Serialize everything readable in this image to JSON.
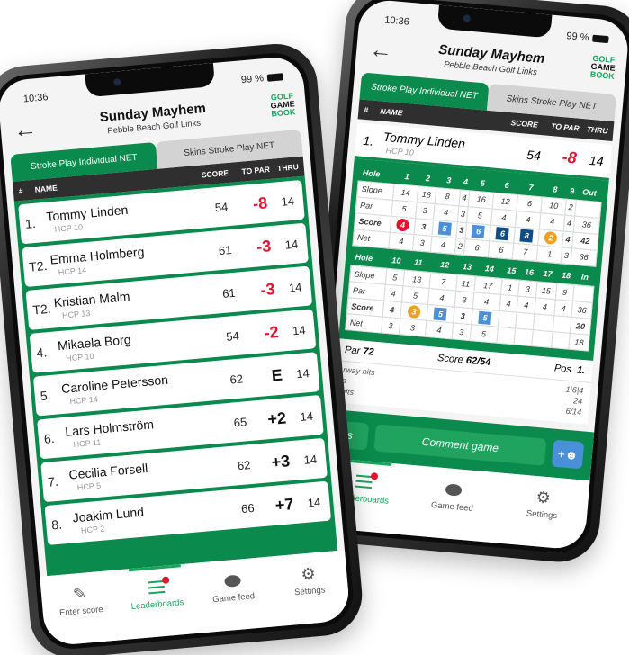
{
  "status": {
    "time": "10:36",
    "battery": "99 %"
  },
  "header": {
    "back_icon": "arrow-left",
    "title": "Sunday Mayhem",
    "subtitle": "Pebble Beach Golf Links",
    "logo": [
      "GOLF",
      "GAME",
      "BOOK"
    ]
  },
  "tabs": [
    {
      "label": "Stroke Play Individual NET",
      "active": true
    },
    {
      "label": "Skins Stroke Play NET",
      "active": false
    }
  ],
  "columns": {
    "num": "#",
    "name": "NAME",
    "score": "SCORE",
    "to_par": "TO PAR",
    "thru": "THRU"
  },
  "leaderboard": [
    {
      "pos": "1.",
      "name": "Tommy Linden",
      "hcp": "HCP 10",
      "score": "54",
      "to_par": "-8",
      "thru": "14"
    },
    {
      "pos": "T2.",
      "name": "Emma Holmberg",
      "hcp": "HCP 14",
      "score": "61",
      "to_par": "-3",
      "thru": "14"
    },
    {
      "pos": "T2.",
      "name": "Kristian Malm",
      "hcp": "HCP 13",
      "score": "61",
      "to_par": "-3",
      "thru": "14"
    },
    {
      "pos": "4.",
      "name": "Mikaela Borg",
      "hcp": "HCP 10",
      "score": "54",
      "to_par": "-2",
      "thru": "14"
    },
    {
      "pos": "5.",
      "name": "Caroline Petersson",
      "hcp": "HCP 14",
      "score": "62",
      "to_par": "E",
      "thru": "14"
    },
    {
      "pos": "6.",
      "name": "Lars Holmström",
      "hcp": "HCP 11",
      "score": "65",
      "to_par": "+2",
      "thru": "14"
    },
    {
      "pos": "7.",
      "name": "Cecilia Forsell",
      "hcp": "HCP 5",
      "score": "62",
      "to_par": "+3",
      "thru": "14"
    },
    {
      "pos": "8.",
      "name": "Joakim Lund",
      "hcp": "HCP 2",
      "score": "66",
      "to_par": "+7",
      "thru": "14"
    }
  ],
  "bottom_nav": [
    {
      "label": "Enter score",
      "icon": "pencil-icon"
    },
    {
      "label": "Leaderboards",
      "icon": "leaderboard-icon",
      "active": true
    },
    {
      "label": "Game feed",
      "icon": "chat-bubble-icon"
    },
    {
      "label": "Settings",
      "icon": "gear-icon"
    }
  ],
  "detail": {
    "player": {
      "pos": "1.",
      "name": "Tommy Linden",
      "hcp": "HCP 10",
      "score": "54",
      "to_par": "-8",
      "thru": "14"
    },
    "front": {
      "hole_label": "Hole",
      "holes": [
        "1",
        "2",
        "3",
        "4",
        "5",
        "6",
        "7",
        "8",
        "9"
      ],
      "total_label": "Out",
      "slope": {
        "label": "Slope",
        "values": [
          "14",
          "18",
          "8",
          "4",
          "16",
          "12",
          "6",
          "10",
          "2"
        ],
        "total": ""
      },
      "par": {
        "label": "Par",
        "values": [
          "5",
          "3",
          "4",
          "3",
          "5",
          "4",
          "4",
          "4",
          "4"
        ],
        "total": "36"
      },
      "score": {
        "label": "Score",
        "values": [
          "4",
          "3",
          "5",
          "3",
          "6",
          "6",
          "8",
          "2",
          "4"
        ],
        "marks": [
          "eagle",
          "",
          "bogey",
          "",
          "bogey",
          "dbl",
          "dbl",
          "birdie",
          ""
        ],
        "total": "42"
      },
      "net": {
        "label": "Net",
        "values": [
          "4",
          "3",
          "4",
          "2",
          "6",
          "6",
          "7",
          "1",
          "3"
        ],
        "total": "36"
      }
    },
    "back": {
      "hole_label": "Hole",
      "holes": [
        "10",
        "11",
        "12",
        "13",
        "14",
        "15",
        "16",
        "17",
        "18"
      ],
      "total_label": "In",
      "slope": {
        "label": "Slope",
        "values": [
          "5",
          "13",
          "7",
          "11",
          "17",
          "1",
          "3",
          "15",
          "9"
        ],
        "total": ""
      },
      "par": {
        "label": "Par",
        "values": [
          "4",
          "5",
          "4",
          "3",
          "4",
          "4",
          "4",
          "4",
          "4"
        ],
        "total": "36"
      },
      "score": {
        "label": "Score",
        "values": [
          "4",
          "3",
          "5",
          "3",
          "5",
          "",
          "",
          "",
          ""
        ],
        "marks": [
          "",
          "birdie",
          "bogey",
          "",
          "bogey",
          "",
          "",
          "",
          ""
        ],
        "total": "20"
      },
      "net": {
        "label": "Net",
        "values": [
          "3",
          "3",
          "4",
          "3",
          "5",
          "",
          "",
          "",
          ""
        ],
        "total": "18"
      }
    },
    "summary": {
      "par_label": "Par",
      "par": "72",
      "score_label": "Score",
      "score": "62/54",
      "pos_label": "Pos.",
      "pos": "1."
    },
    "stats": [
      {
        "label": "rway hits",
        "value": "1|6|4"
      },
      {
        "label": "s",
        "value": "24"
      },
      {
        "label": "hits",
        "value": "6/14"
      }
    ],
    "actions": {
      "partial_label": "s",
      "comment_label": "Comment game",
      "add_player_icon": "add-user-icon"
    }
  },
  "colors": {
    "green": "#0a8a4c",
    "red": "#e8112d",
    "orange": "#f0a020",
    "blue": "#4a90d9",
    "dark_blue": "#0f4c8a"
  }
}
